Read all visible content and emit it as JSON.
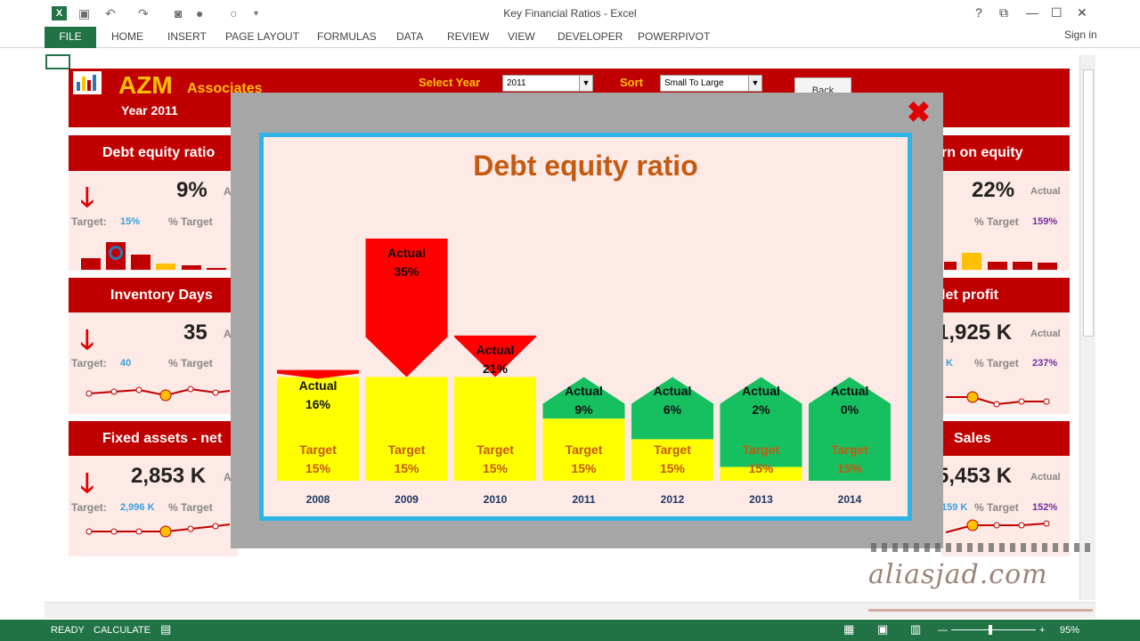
{
  "window": {
    "title": "Key Financial Ratios - Excel",
    "help": "?",
    "restore_ribbon": "⧉",
    "minimize": "—",
    "maximize": "☐",
    "close": "✕"
  },
  "quick_access": {
    "excel_logo": "X",
    "icons": [
      "save-icon",
      "undo-icon",
      "redo-icon",
      "camera-icon",
      "circle-icon",
      "customize-icon"
    ]
  },
  "ribbon": {
    "file": "FILE",
    "tabs": [
      "HOME",
      "INSERT",
      "PAGE LAYOUT",
      "FORMULAS",
      "DATA",
      "REVIEW",
      "VIEW",
      "DEVELOPER",
      "POWERPIVOT"
    ],
    "signin": "Sign in"
  },
  "dashboard": {
    "brand": "AZM",
    "brand_sub": "Associates",
    "year_label": "Year 2011",
    "select_year_label": "Select Year",
    "select_year_value": "2011",
    "sort_label": "Sort",
    "sort_value": "Small To Large",
    "back_button": "Back"
  },
  "panels": {
    "debt_equity": {
      "title": "Debt equity ratio",
      "arrow": "🡓",
      "value": "9%",
      "actual": "Act",
      "target_label": "Target:",
      "target_value": "15%",
      "pct_target": "% Target"
    },
    "inventory": {
      "title": "Inventory Days",
      "arrow": "🡓",
      "value": "35",
      "actual": "A",
      "target_label": "Target:",
      "target_value": "40",
      "pct_target": "% Target"
    },
    "fixed_assets": {
      "title": "Fixed assets - net",
      "arrow": "🡓",
      "value": "2,853 K",
      "actual": "A",
      "target_label": "Target:",
      "target_value": "2,996 K",
      "pct_target": "% Target"
    },
    "return_equity": {
      "title": "rn on equity",
      "value": "22%",
      "actual": "Actual",
      "pct_target": "% Target",
      "pct_value": "159%"
    },
    "net_profit": {
      "title": "let profit",
      "value": "1,925 K",
      "actual": "Actual",
      "target_value": "K",
      "pct_target": "% Target",
      "pct_value": "237%"
    },
    "sales": {
      "title": "Sales",
      "value": "5,453 K",
      "actual": "Actual",
      "target_value": "159 K",
      "pct_target": "% Target",
      "pct_value": "152%"
    }
  },
  "modal": {
    "close_icon": "✖",
    "title": "Debt equity ratio"
  },
  "chart_data": {
    "type": "bar",
    "title": "Debt equity ratio",
    "categories": [
      "2008",
      "2009",
      "2010",
      "2011",
      "2012",
      "2013",
      "2014"
    ],
    "series": [
      {
        "name": "Actual",
        "values": [
          16,
          35,
          21,
          9,
          6,
          2,
          0
        ]
      },
      {
        "name": "Target",
        "values": [
          15,
          15,
          15,
          15,
          15,
          15,
          15
        ]
      }
    ],
    "labels": {
      "actual": "Actual",
      "target": "Target"
    },
    "actual_text": [
      "16%",
      "35%",
      "21%",
      "9%",
      "6%",
      "2%",
      "0%"
    ],
    "target_text": [
      "15%",
      "15%",
      "15%",
      "15%",
      "15%",
      "15%",
      "15%"
    ],
    "colors": {
      "above_target": "#ff0000",
      "below_target": "#16c060",
      "target": "#ffff00"
    }
  },
  "statusbar": {
    "ready": "READY",
    "calculate": "CALCULATE",
    "zoom": "95%",
    "zoom_out": "—",
    "zoom_in": "+"
  },
  "watermark": {
    "text": "aliasjad.com"
  }
}
